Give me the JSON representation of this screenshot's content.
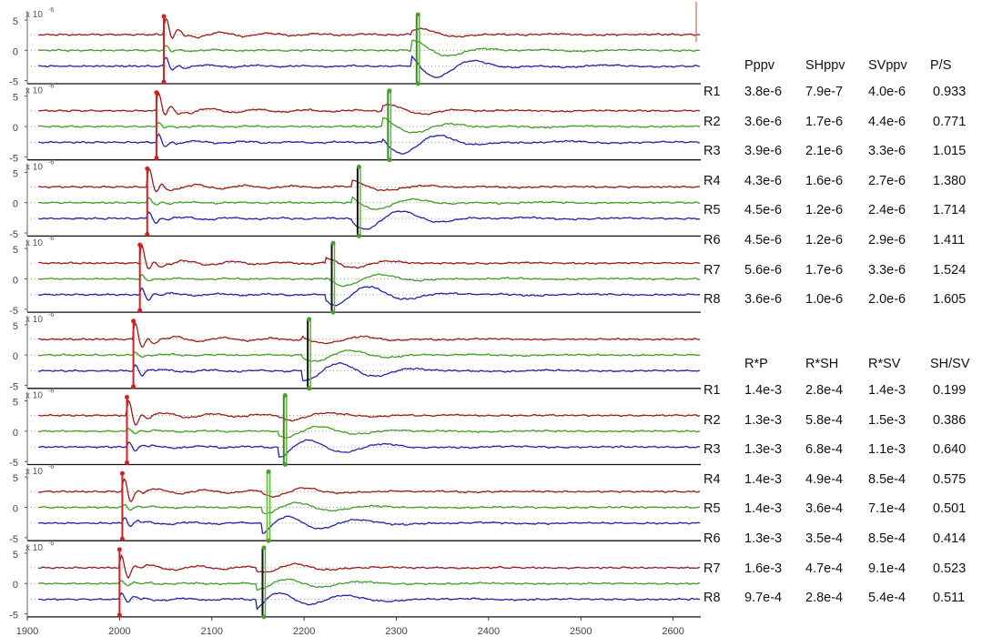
{
  "chart_data": {
    "type": "line",
    "x_ticks": [
      1900,
      2000,
      2100,
      2200,
      2300,
      2400,
      2500,
      2600
    ],
    "xlim": [
      1900,
      2630
    ],
    "ylim": [
      -5.5,
      6.5
    ],
    "y_ticks": [
      5,
      0,
      -5
    ],
    "y_exponent_label": "x 10",
    "y_exponent": "-6",
    "series_colors": {
      "red": "#9c1b1b",
      "green": "#3fa026",
      "blue": "#2424a8"
    },
    "panels": [
      {
        "id": "R1",
        "p_arrival": 2048,
        "s_arrival": 2322,
        "s_marker_color": "#3a8a23"
      },
      {
        "id": "R2",
        "p_arrival": 2040,
        "s_arrival": 2291,
        "s_marker_color": "#3a8a23"
      },
      {
        "id": "R3",
        "p_arrival": 2030,
        "s_arrival": 2258,
        "s_marker_color": "#111111"
      },
      {
        "id": "R4",
        "p_arrival": 2022,
        "s_arrival": 2230,
        "s_marker_color": "#111111"
      },
      {
        "id": "R5",
        "p_arrival": 2015,
        "s_arrival": 2204,
        "s_marker_color": "#111111"
      },
      {
        "id": "R6",
        "p_arrival": 2008,
        "s_arrival": 2178,
        "s_marker_color": "#3a8a23"
      },
      {
        "id": "R7",
        "p_arrival": 2003,
        "s_arrival": 2160,
        "s_marker_color": "#7ac24e"
      },
      {
        "id": "R8",
        "p_arrival": 2000,
        "s_arrival": 2155,
        "s_marker_color": "#111111"
      }
    ]
  },
  "table_ppv": {
    "headers": [
      "Pppv",
      "SHppv",
      "SVppv",
      "P/S"
    ],
    "rows": [
      {
        "label": "R1",
        "values": [
          "3.8e-6",
          "7.9e-7",
          "4.0e-6",
          "0.933"
        ]
      },
      {
        "label": "R2",
        "values": [
          "3.6e-6",
          "1.7e-6",
          "4.4e-6",
          "0.771"
        ]
      },
      {
        "label": "R3",
        "values": [
          "3.9e-6",
          "2.1e-6",
          "3.3e-6",
          "1.015"
        ]
      },
      {
        "label": "R4",
        "values": [
          "4.3e-6",
          "1.6e-6",
          "2.7e-6",
          "1.380"
        ]
      },
      {
        "label": "R5",
        "values": [
          "4.5e-6",
          "1.2e-6",
          "2.4e-6",
          "1.714"
        ]
      },
      {
        "label": "R6",
        "values": [
          "4.5e-6",
          "1.2e-6",
          "2.9e-6",
          "1.411"
        ]
      },
      {
        "label": "R7",
        "values": [
          "5.6e-6",
          "1.7e-6",
          "3.3e-6",
          "1.524"
        ]
      },
      {
        "label": "R8",
        "values": [
          "3.6e-6",
          "1.0e-6",
          "2.0e-6",
          "1.605"
        ]
      }
    ]
  },
  "table_rp": {
    "headers": [
      "R*P",
      "R*SH",
      "R*SV",
      "SH/SV"
    ],
    "rows": [
      {
        "label": "R1",
        "values": [
          "1.4e-3",
          "2.8e-4",
          "1.4e-3",
          "0.199"
        ]
      },
      {
        "label": "R2",
        "values": [
          "1.3e-3",
          "5.8e-4",
          "1.5e-3",
          "0.386"
        ]
      },
      {
        "label": "R3",
        "values": [
          "1.3e-3",
          "6.8e-4",
          "1.1e-3",
          "0.640"
        ]
      },
      {
        "label": "R4",
        "values": [
          "1.4e-3",
          "4.9e-4",
          "8.5e-4",
          "0.575"
        ]
      },
      {
        "label": "R5",
        "values": [
          "1.4e-3",
          "3.6e-4",
          "7.1e-4",
          "0.501"
        ]
      },
      {
        "label": "R6",
        "values": [
          "1.3e-3",
          "3.5e-4",
          "8.5e-4",
          "0.414"
        ]
      },
      {
        "label": "R7",
        "values": [
          "1.6e-3",
          "4.7e-4",
          "9.1e-4",
          "0.523"
        ]
      },
      {
        "label": "R8",
        "values": [
          "9.7e-4",
          "2.8e-4",
          "5.4e-4",
          "0.511"
        ]
      }
    ]
  }
}
